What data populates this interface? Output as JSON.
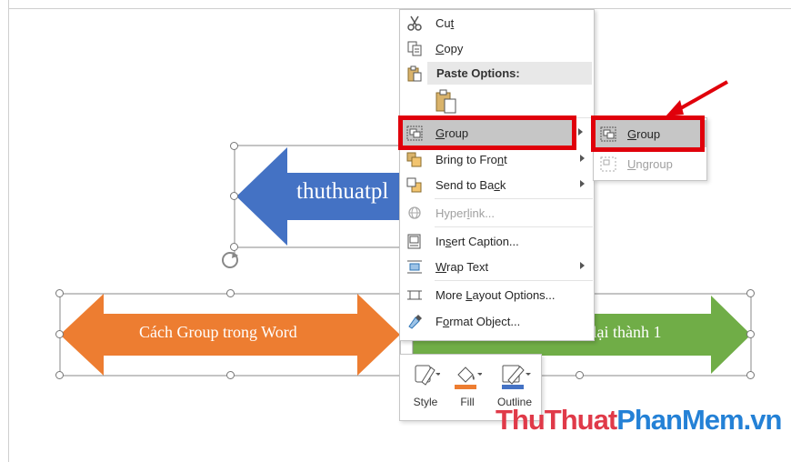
{
  "shapes": {
    "blue_arrow_text": "thuthuatpl",
    "orange_arrow_text": "Cách Group trong Word",
    "green_arrow_text": "Nhóm nhiều hình lại thành 1"
  },
  "context_menu": {
    "items": [
      {
        "label": "Cut",
        "mnemonic_index": 2,
        "icon": "scissors-icon"
      },
      {
        "label": "Copy",
        "mnemonic_index": 0,
        "icon": "copy-icon"
      },
      {
        "label": "Paste Options:",
        "icon": "paste-icon"
      },
      {
        "label": "Group",
        "mnemonic_index": 0,
        "icon": "group-icon",
        "has_submenu": true,
        "highlighted": true
      },
      {
        "label": "Bring to Front",
        "mnemonic_index": 12,
        "icon": "bring-to-front-icon",
        "has_submenu": true
      },
      {
        "label": "Send to Back",
        "mnemonic_index": 10,
        "icon": "send-to-back-icon",
        "has_submenu": true
      },
      {
        "label": "Hyperlink...",
        "mnemonic_index": 5,
        "icon": "hyperlink-icon",
        "disabled": true
      },
      {
        "label": "Insert Caption...",
        "mnemonic_index": 2,
        "icon": "insert-caption-icon"
      },
      {
        "label": "Wrap Text",
        "mnemonic_index": 0,
        "icon": "wrap-text-icon",
        "has_submenu": true
      },
      {
        "label": "More Layout Options...",
        "mnemonic_index": 5,
        "icon": "layout-options-icon"
      },
      {
        "label": "Format Object...",
        "mnemonic_index": 1,
        "icon": "format-object-icon"
      }
    ]
  },
  "submenu": {
    "items": [
      {
        "label": "Group",
        "mnemonic_index": 0,
        "icon": "group-icon",
        "highlighted": true
      },
      {
        "label": "Ungroup",
        "mnemonic_index": 0,
        "icon": "ungroup-icon",
        "disabled": true
      }
    ]
  },
  "mini_toolbar": {
    "style_label": "Style",
    "fill_label": "Fill",
    "outline_label": "Outline"
  },
  "watermark": {
    "part1": "ThuThuat",
    "part2": "PhanMem.vn"
  },
  "colors": {
    "blue_arrow": "#4472c4",
    "orange_arrow": "#ed7d31",
    "green_arrow": "#70ad47",
    "highlight_red": "#e0000b",
    "menu_hover": "#c6c6c6"
  }
}
